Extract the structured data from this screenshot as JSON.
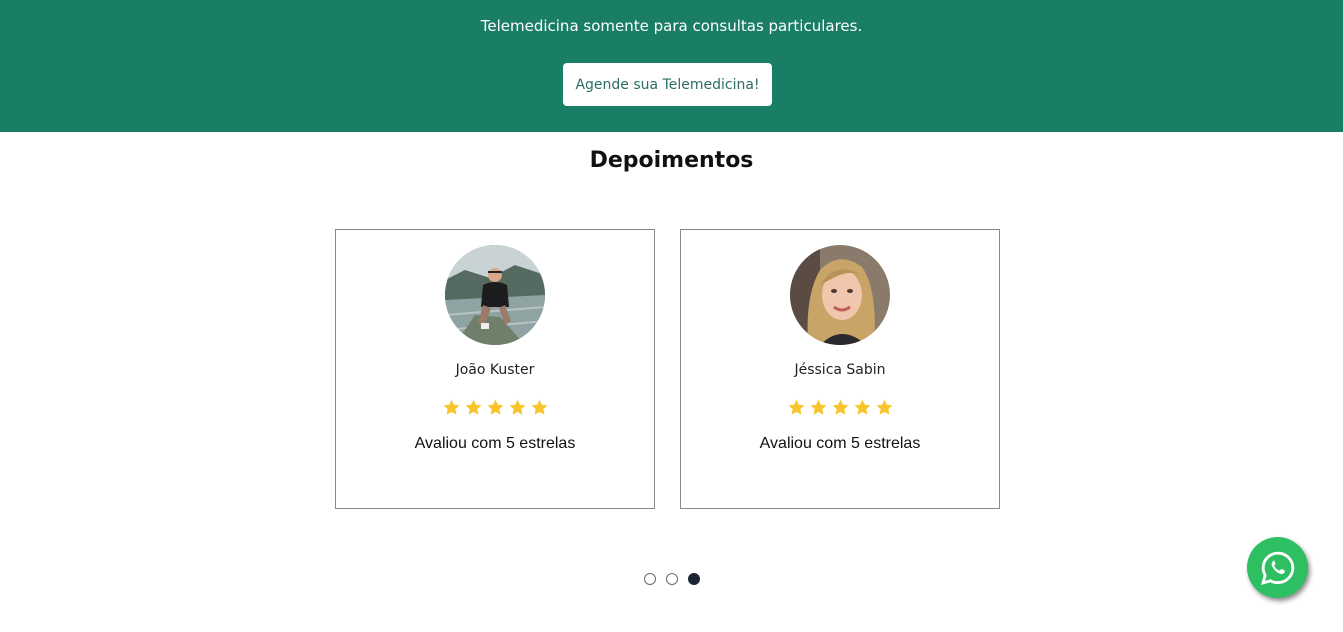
{
  "banner": {
    "text": "Telemedicina somente para consultas particulares.",
    "button_label": "Agende sua Telemedicina!",
    "background_color": "#1a7e66"
  },
  "testimonials": {
    "title": "Depoimentos",
    "items": [
      {
        "name": "João Kuster",
        "stars": 5,
        "rating_text": "Avaliou com 5 estrelas",
        "avatar": "photo-man-avatar"
      },
      {
        "name": "Jéssica Sabin",
        "stars": 5,
        "rating_text": "Avaliou com 5 estrelas",
        "avatar": "photo-woman-avatar"
      }
    ],
    "star_color": "#f7c52b"
  },
  "carousel": {
    "pages": 3,
    "active_page": 3
  },
  "floating": {
    "whatsapp_icon": "whatsapp-icon",
    "whatsapp_color": "#2dbf62"
  }
}
